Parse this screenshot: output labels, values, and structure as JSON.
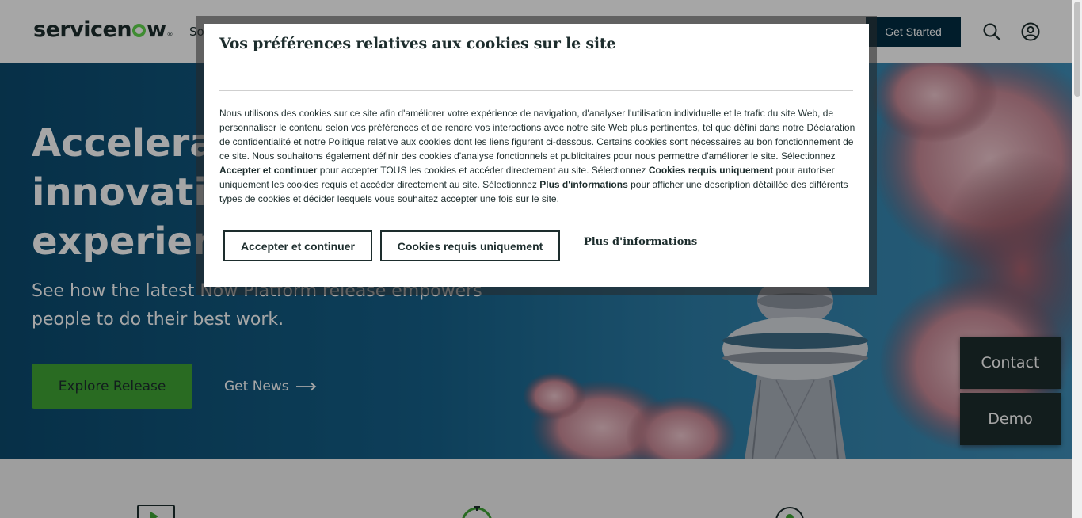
{
  "header": {
    "logo": "servicenow",
    "nav_partial": "So",
    "get_started_label": "Get Started",
    "search_icon": "search-icon",
    "user_icon": "user-account-icon"
  },
  "hero": {
    "title_lines": [
      "Accelerate",
      "innovation",
      "experience"
    ],
    "subtitle": "See how the latest Now Platform release empowers people to do their best work.",
    "explore_label": "Explore Release",
    "get_news_label": "Get News"
  },
  "side_buttons": {
    "contact_label": "Contact",
    "demo_label": "Demo"
  },
  "cookie_modal": {
    "title": "Vos préférences relatives aux cookies sur le site",
    "body_part1": "Nous utilisons des cookies sur ce site afin d'améliorer votre expérience de navigation, d'analyser l'utilisation individuelle et le trafic du site Web, de personnaliser le contenu selon vos préférences et de rendre vos interactions avec notre site Web plus pertinentes, tel que défini dans notre Déclaration de confidentialité et notre Politique relative aux cookies dont les liens figurent ci-dessous. Certains cookies sont nécessaires au bon fonctionnement de ce site. Nous souhaitons également définir des cookies d'analyse fonctionnels et publicitaires pour nous permettre d'améliorer le site. Sélectionnez ",
    "bold1": "Accepter et continuer",
    "body_part2": " pour accepter TOUS les cookies et accéder directement au site. Sélectionnez ",
    "bold2": "Cookies requis uniquement",
    "body_part3": " pour autoriser uniquement les cookies requis et accéder directement au site. Sélectionnez ",
    "bold3": "Plus d'informations",
    "body_part4": " pour afficher une description détaillée des différents types de cookies et décider lesquels vous souhaitez accepter une fois sur le site.",
    "accept_label": "Accepter et continuer",
    "required_label": "Cookies requis uniquement",
    "more_info_label": "Plus d'informations"
  },
  "colors": {
    "brand_green": "#62d84e",
    "button_green": "#3fa535",
    "dark_navy": "#032d42",
    "dark_teal": "#1d2d2d"
  }
}
